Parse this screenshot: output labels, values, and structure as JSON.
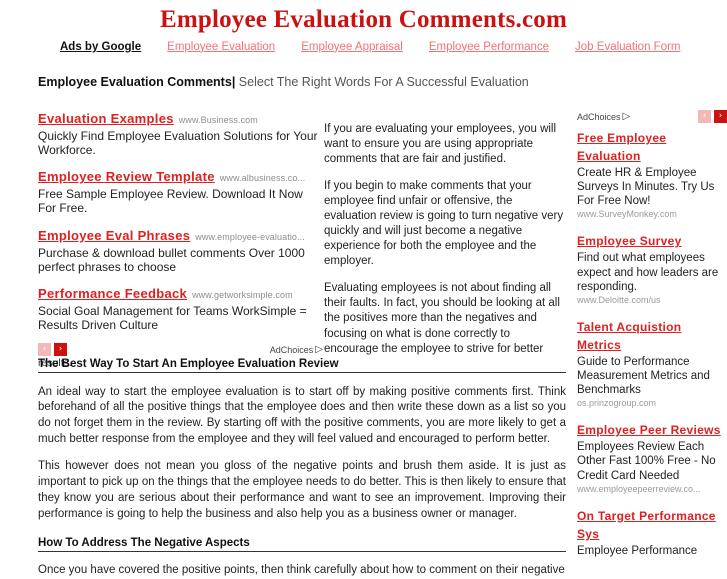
{
  "header": {
    "site_title": "Employee Evaluation Comments.com",
    "ads_by_google_label": "Ads by Google",
    "nav_links": [
      "Employee Evaluation",
      "Employee Appraisal",
      "Employee Performance",
      "Job Evaluation Form"
    ],
    "page_title": "Employee Evaluation Comments",
    "separator": "|",
    "tagline": "Select The Right Words For A Successful Evaluation"
  },
  "colors": {
    "brand_red": "#cc1111",
    "ad_title_red": "#e02020",
    "nav_link_red": "#f47272",
    "arrow_disabled": "#f2b8b8",
    "url_gray": "#8d8d8d"
  },
  "left_ads": {
    "items": [
      {
        "title": "Evaluation Examples",
        "url": "www.Business.com",
        "desc": "Quickly Find Employee Evaluation Solutions for Your Workforce."
      },
      {
        "title": "Employee Review Template",
        "url": "www.albusiness.co...",
        "desc": "Free Sample Employee Review. Download It Now For Free."
      },
      {
        "title": "Employee Eval Phrases",
        "url": "www.employee-evaluatio...",
        "desc": "Purchase & download bullet comments Over 1000 perfect phrases to choose"
      },
      {
        "title": "Performance Feedback",
        "url": "www.getworksimple.com",
        "desc": "Social Goal Management for Teams WorkSimple = Results Driven Culture"
      }
    ],
    "prev_arrow": "‹",
    "next_arrow": "›",
    "adchoices_label": "AdChoices",
    "adchoices_icon": "▷",
    "results_text": "results."
  },
  "middle": {
    "paragraphs": [
      "If you are evaluating your employees, you will want to ensure you are using appropriate comments that are fair and justified.",
      "If you begin to make comments that your employee find unfair or offensive, the evaluation review is going to turn negative very quickly and will just become a negative experience for both the employee and the employer.",
      "Evaluating employees is not about finding all their faults. In fact, you should be looking at all the positives more than the negatives and focusing on what is done correctly to encourage the employee to strive for better"
    ]
  },
  "right_ads": {
    "adchoices_label": "AdChoices",
    "adchoices_icon": "▷",
    "prev_arrow": "‹",
    "next_arrow": "›",
    "items": [
      {
        "title": "Free Employee Evaluation",
        "desc": "Create HR & Employee Surveys In Minutes. Try Us For Free Now!",
        "url": "www.SurveyMonkey.com"
      },
      {
        "title": "Employee Survey",
        "desc": "Find out what employees expect and how leaders are responding.",
        "url": "www.Deloitte.com/us"
      },
      {
        "title": "Talent Acquistion Metrics",
        "desc": "Guide to Performance Measurement Metrics and Benchmarks",
        "url": "os.prinzogroup.com"
      },
      {
        "title": "Employee Peer Reviews",
        "desc": "Employees Review Each Other Fast 100% Free - No Credit Card Needed",
        "url": "www.employeepeerreview.co..."
      },
      {
        "title": "On Target Performance Sys",
        "desc": "Employee Performance",
        "url": ""
      }
    ]
  },
  "article": {
    "heading1": "The Best Way To Start An Employee Evaluation Review",
    "para1": "An ideal way to start the employee evaluation is to start off by making positive comments first. Think beforehand of all the positive things that the employee does and then write these down as a list so you do not forget them in the review. By starting off with the positive comments, you are more likely to get a much better response from the employee and they will feel valued and encouraged to perform better.",
    "para2": "This however does not mean you gloss of the negative points and brush them aside. It is just as important to pick up on the things that the employee needs to do better. This is then likely to ensure that they know you are serious about their performance and want to see an improvement. Improving their performance is going to help the business and also help you as a business owner or manager.",
    "heading2": "How To Address The Negative Aspects",
    "para3": "Once you have covered the positive points, then think carefully about how to comment on their negative"
  }
}
